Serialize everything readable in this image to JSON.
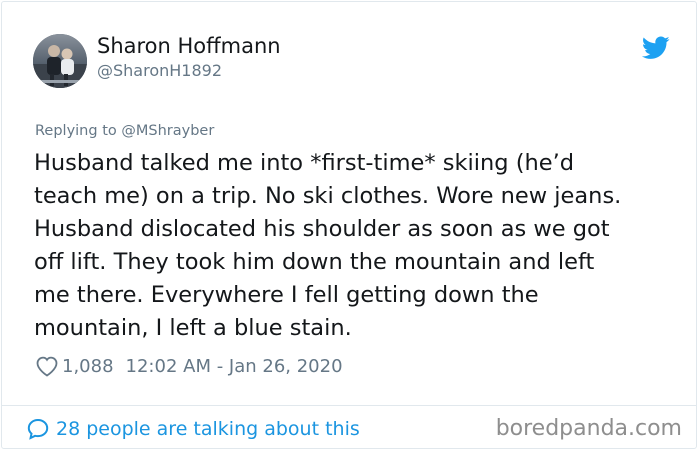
{
  "user": {
    "display_name": "Sharon Hoffmann",
    "handle": "@SharonH1892",
    "avatar_icon": "profile-photo"
  },
  "brand": {
    "logo_icon": "twitter-bird-icon",
    "accent_color": "#1da1f2",
    "link_color": "#1b95e0"
  },
  "reply": {
    "prefix": "Replying to ",
    "mention": "@MShrayber"
  },
  "tweet": {
    "lines": [
      "Husband talked me into *first-time* skiing (he’d",
      "teach me) on a trip. No ski clothes. Wore new jeans.",
      "Husband dislocated his shoulder as soon as we got",
      "off lift. They took him down the mountain and left",
      "me there. Everywhere I fell getting down the",
      "mountain, I left a blue stain."
    ]
  },
  "meta": {
    "heart_icon": "heart-outline-icon",
    "likes": "1,088",
    "timestamp": "12:02 AM - Jan 26, 2020"
  },
  "footer": {
    "bubble_icon": "speech-bubble-icon",
    "talking": "28 people are talking about this",
    "watermark": "boredpanda.com"
  }
}
